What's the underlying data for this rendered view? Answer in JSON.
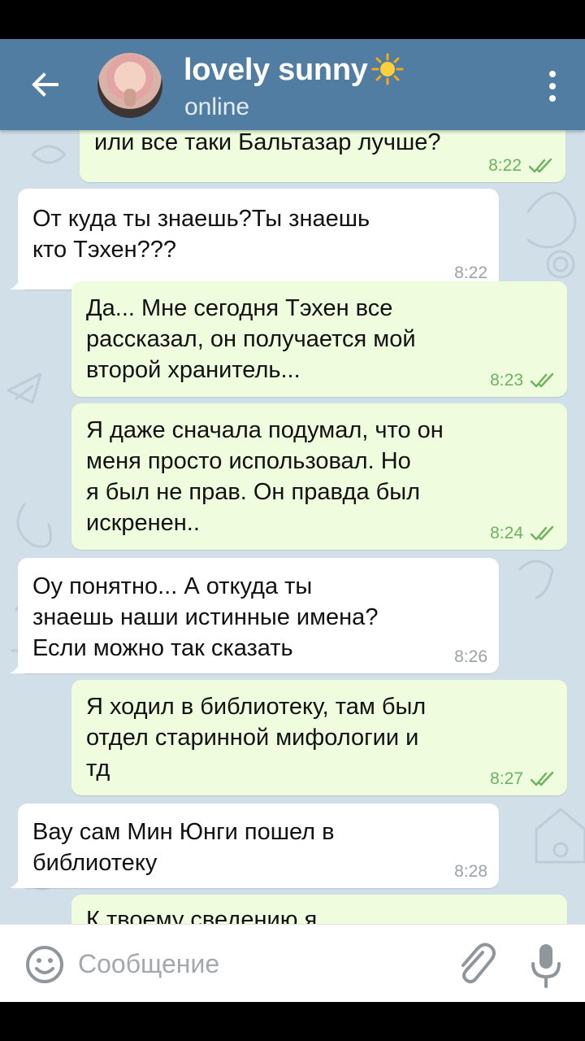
{
  "header": {
    "title": "lovely sunny",
    "status": "online"
  },
  "messages": [
    {
      "dir": "out",
      "text": "или все таки Бальтазар лучше?",
      "time": "8:22",
      "read": true
    },
    {
      "dir": "in",
      "text": "От куда ты знаешь?Ты знаешь\nкто Тэхен???",
      "time": "8:22"
    },
    {
      "dir": "out",
      "text": "Да... Мне сегодня Тэхен все\nрассказал, он получается мой\nвторой хранитель...",
      "time": "8:23",
      "read": true
    },
    {
      "dir": "out",
      "text": "Я даже сначала подумал, что он\nменя просто использовал. Но\nя был не прав. Он правда был\nискренен..",
      "time": "8:24",
      "read": true
    },
    {
      "dir": "in",
      "text": "Оу понятно...  А откуда ты\nзнаешь наши истинные имена?\nЕсли можно так сказать",
      "time": "8:26"
    },
    {
      "dir": "out",
      "text": "Я ходил в библиотеку, там был\nотдел старинной мифологии и\nтд",
      "time": "8:27",
      "read": true
    },
    {
      "dir": "in",
      "text": "Вау сам Мин Юнги пошел в\nбиблиотеку",
      "time": "8:28"
    },
    {
      "dir": "out",
      "text": "К твоему сведению я",
      "time": "",
      "read": true
    }
  ],
  "input": {
    "placeholder": "Сообщение",
    "value": ""
  },
  "colors": {
    "header": "#517da2",
    "chat_background": "#d1dfe9",
    "incoming_bubble": "#ffffff",
    "outgoing_bubble": "#effdde",
    "read_check": "#6bb35e"
  },
  "icons": [
    "back-arrow-icon",
    "sun-emoji-icon",
    "more-vertical-icon",
    "double-check-icon",
    "emoji-icon",
    "paperclip-icon",
    "microphone-icon"
  ]
}
